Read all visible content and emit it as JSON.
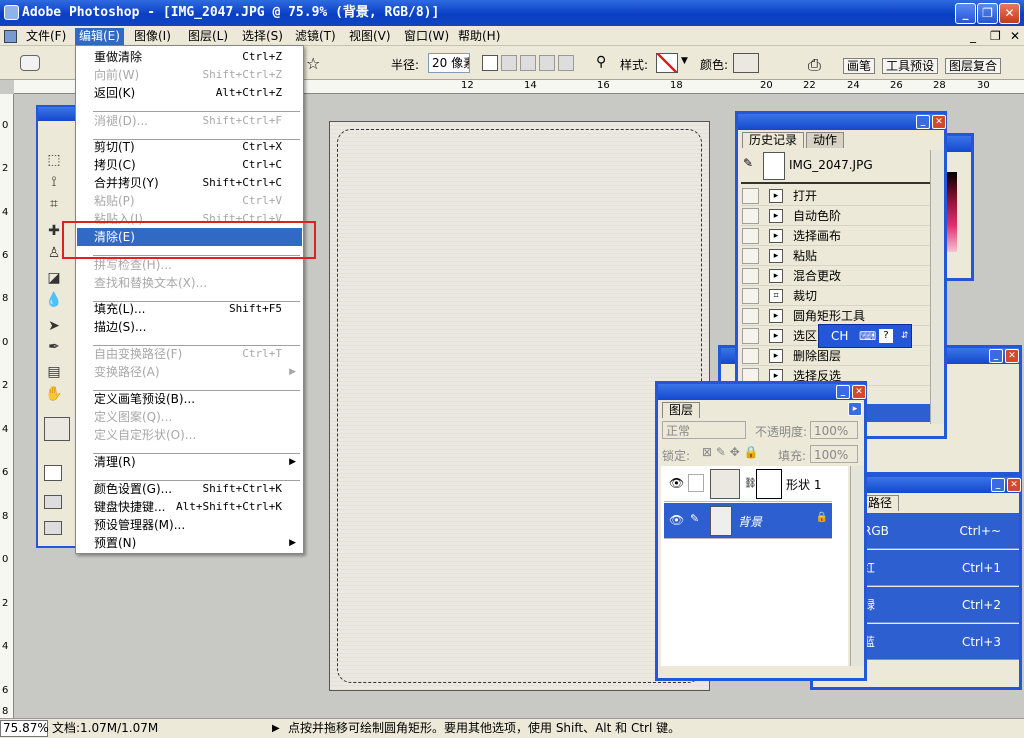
{
  "window": {
    "title": "Adobe Photoshop - [IMG_2047.JPG @ 75.9% (背景, RGB/8)]",
    "minimize": "_",
    "restore": "❐",
    "close": "✕"
  },
  "menubar": {
    "items": [
      "文件(F)",
      "编辑(E)",
      "图像(I)",
      "图层(L)",
      "选择(S)",
      "滤镜(T)",
      "视图(V)",
      "窗口(W)",
      "帮助(H)"
    ],
    "doc_controls": [
      "_",
      "❐",
      "✕"
    ]
  },
  "options": {
    "radius_label": "半径:",
    "radius_value": "20 像素",
    "style_label": "样式:",
    "color_label": "颜色:",
    "palette_tabs": [
      "画笔",
      "工具预设",
      "图层复合"
    ]
  },
  "edit_menu": {
    "items": [
      {
        "label": "重做清除",
        "shortcut": "Ctrl+Z",
        "disabled": false
      },
      {
        "label": "向前(W)",
        "shortcut": "Shift+Ctrl+Z",
        "disabled": true
      },
      {
        "label": "返回(K)",
        "shortcut": "Alt+Ctrl+Z",
        "disabled": false
      },
      {
        "label": "消褪(D)...",
        "shortcut": "Shift+Ctrl+F",
        "disabled": true
      },
      {
        "label": "剪切(T)",
        "shortcut": "Ctrl+X",
        "disabled": false
      },
      {
        "label": "拷贝(C)",
        "shortcut": "Ctrl+C",
        "disabled": false
      },
      {
        "label": "合并拷贝(Y)",
        "shortcut": "Shift+Ctrl+C",
        "disabled": false
      },
      {
        "label": "粘贴(P)",
        "shortcut": "Ctrl+V",
        "disabled": true
      },
      {
        "label": "粘贴入(I)",
        "shortcut": "Shift+Ctrl+V",
        "disabled": true
      },
      {
        "label": "清除(E)",
        "shortcut": "",
        "disabled": false,
        "selected": true
      },
      {
        "label": "拼写检查(H)...",
        "shortcut": "",
        "disabled": true
      },
      {
        "label": "查找和替换文本(X)...",
        "shortcut": "",
        "disabled": true
      },
      {
        "label": "填充(L)...",
        "shortcut": "Shift+F5",
        "disabled": false
      },
      {
        "label": "描边(S)...",
        "shortcut": "",
        "disabled": false
      },
      {
        "label": "自由变换路径(F)",
        "shortcut": "Ctrl+T",
        "disabled": true
      },
      {
        "label": "变换路径(A)",
        "shortcut": "",
        "disabled": true,
        "submenu": true
      },
      {
        "label": "定义画笔预设(B)...",
        "shortcut": "",
        "disabled": false
      },
      {
        "label": "定义图案(Q)...",
        "shortcut": "",
        "disabled": true
      },
      {
        "label": "定义自定形状(O)...",
        "shortcut": "",
        "disabled": true
      },
      {
        "label": "清理(R)",
        "shortcut": "",
        "disabled": false,
        "submenu": true
      },
      {
        "label": "颜色设置(G)...",
        "shortcut": "Shift+Ctrl+K",
        "disabled": false
      },
      {
        "label": "键盘快捷键...",
        "shortcut": "Alt+Shift+Ctrl+K",
        "disabled": false
      },
      {
        "label": "预设管理器(M)...",
        "shortcut": "",
        "disabled": false
      },
      {
        "label": "预置(N)",
        "shortcut": "",
        "disabled": false,
        "submenu": true
      }
    ]
  },
  "history": {
    "tabs": [
      "历史记录",
      "动作"
    ],
    "snapshot": "IMG_2047.JPG",
    "steps": [
      "打开",
      "自动色阶",
      "选择画布",
      "粘贴",
      "混合更改",
      "裁切",
      "圆角矩形工具",
      "选区",
      "删除图层",
      "选择反选"
    ]
  },
  "ime": {
    "lang": "CH"
  },
  "layers": {
    "tab": "图层",
    "blend_mode": "正常",
    "opacity_label": "不透明度:",
    "opacity": "100%",
    "lock_label": "锁定:",
    "fill_label": "填充:",
    "fill": "100%",
    "rows": [
      {
        "name": "形状 1",
        "selected": false
      },
      {
        "name": "背景",
        "selected": true
      }
    ]
  },
  "channels": {
    "tab": "路径",
    "rows": [
      {
        "name": "RGB",
        "shortcut": "Ctrl+~"
      },
      {
        "name": "红",
        "shortcut": "Ctrl+1"
      },
      {
        "name": "绿",
        "shortcut": "Ctrl+2"
      },
      {
        "name": "蓝",
        "shortcut": "Ctrl+3"
      }
    ]
  },
  "status": {
    "zoom": "75.87%",
    "doc": "文档:1.07M/1.07M",
    "hint": "点按并拖移可绘制圆角矩形。要用其他选项，使用 Shift、Alt 和 Ctrl 键。"
  },
  "ruler": {
    "h": [
      "12",
      "14",
      "16",
      "18",
      "20",
      "22",
      "24",
      "26",
      "28",
      "30"
    ],
    "v": [
      "0",
      "2",
      "4",
      "6",
      "8",
      "0",
      "2",
      "4",
      "6",
      "8",
      "0",
      "2",
      "4",
      "6",
      "8"
    ]
  }
}
